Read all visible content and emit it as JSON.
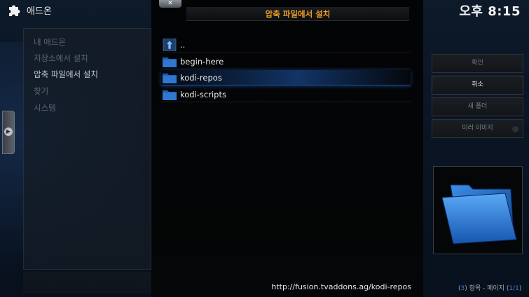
{
  "header": {
    "title": "애드온",
    "clock": "오후 8:15"
  },
  "menu": {
    "items": [
      {
        "label": "내 애드온"
      },
      {
        "label": "저장소에서 설치"
      },
      {
        "label": "압축 파일에서 설치"
      },
      {
        "label": "찾기"
      },
      {
        "label": "시스템"
      }
    ]
  },
  "dialog": {
    "close_label": "✕",
    "title": "압축 파일에서 설치",
    "files": [
      {
        "label": "..",
        "icon": "parent-folder-icon"
      },
      {
        "label": "begin-here",
        "icon": "folder-icon"
      },
      {
        "label": "kodi-repos",
        "icon": "folder-icon"
      },
      {
        "label": "kodi-scripts",
        "icon": "folder-icon"
      }
    ],
    "current_path": "http://fusion.tvaddons.ag/kodi-repos"
  },
  "buttons": {
    "ok": "확인",
    "cancel": "취소",
    "new_folder": "새 폴더",
    "mirror": "미러 이미지"
  },
  "footer": {
    "item_count": "3",
    "items_word": "항목 - 페이지",
    "page": "1/1"
  },
  "colors": {
    "accent": "#f0a020",
    "selection": "#1f4f9a",
    "page_number": "#3d7fd8"
  }
}
